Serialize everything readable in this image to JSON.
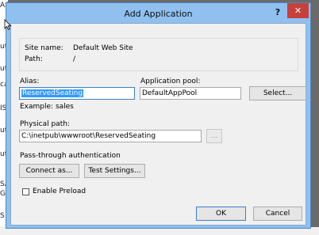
{
  "background": {
    "fragments": [
      "AS",
      "ut",
      "ut",
      "ca",
      "IS",
      "ut",
      "ut",
      "SA",
      "GI",
      "S"
    ]
  },
  "dialog": {
    "title": "Add Application",
    "help_label": "?",
    "close_label": "✕"
  },
  "site": {
    "site_name_label": "Site name:",
    "site_name_value": "Default Web Site",
    "path_label": "Path:",
    "path_value": "/"
  },
  "alias": {
    "label": "Alias:",
    "value": "ReservedSeating",
    "example": "Example: sales"
  },
  "app_pool": {
    "label": "Application pool:",
    "value": "DefaultAppPool",
    "select_button": "Select..."
  },
  "physical_path": {
    "label": "Physical path:",
    "value": "C:\\inetpub\\wwwroot\\ReservedSeating",
    "browse_button": "..."
  },
  "auth": {
    "label": "Pass-through authentication",
    "connect_as_button": "Connect as...",
    "test_settings_button": "Test Settings..."
  },
  "preload": {
    "label": "Enable Preload",
    "checked": false
  },
  "buttons": {
    "ok": "OK",
    "cancel": "Cancel"
  },
  "colors": {
    "window_frame": "#8fc0f0",
    "close_button": "#c7403a",
    "selection": "#3399ff"
  }
}
